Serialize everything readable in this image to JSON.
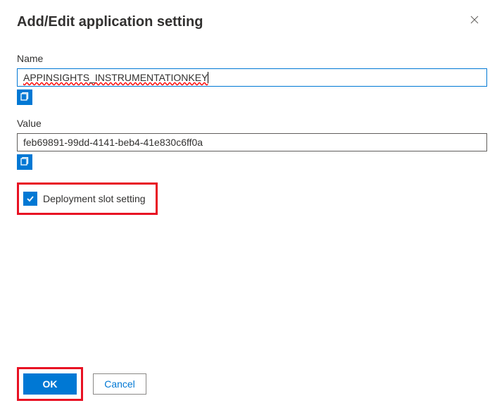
{
  "header": {
    "title": "Add/Edit application setting"
  },
  "fields": {
    "name": {
      "label": "Name",
      "value": "APPINSIGHTS_INSTRUMENTATIONKEY"
    },
    "value": {
      "label": "Value",
      "value": "feb69891-99dd-4141-beb4-41e830c6ff0a"
    }
  },
  "checkbox": {
    "label": "Deployment slot setting",
    "checked": true
  },
  "buttons": {
    "ok": "OK",
    "cancel": "Cancel"
  },
  "colors": {
    "primary": "#0078d4",
    "highlight": "#e81123"
  }
}
